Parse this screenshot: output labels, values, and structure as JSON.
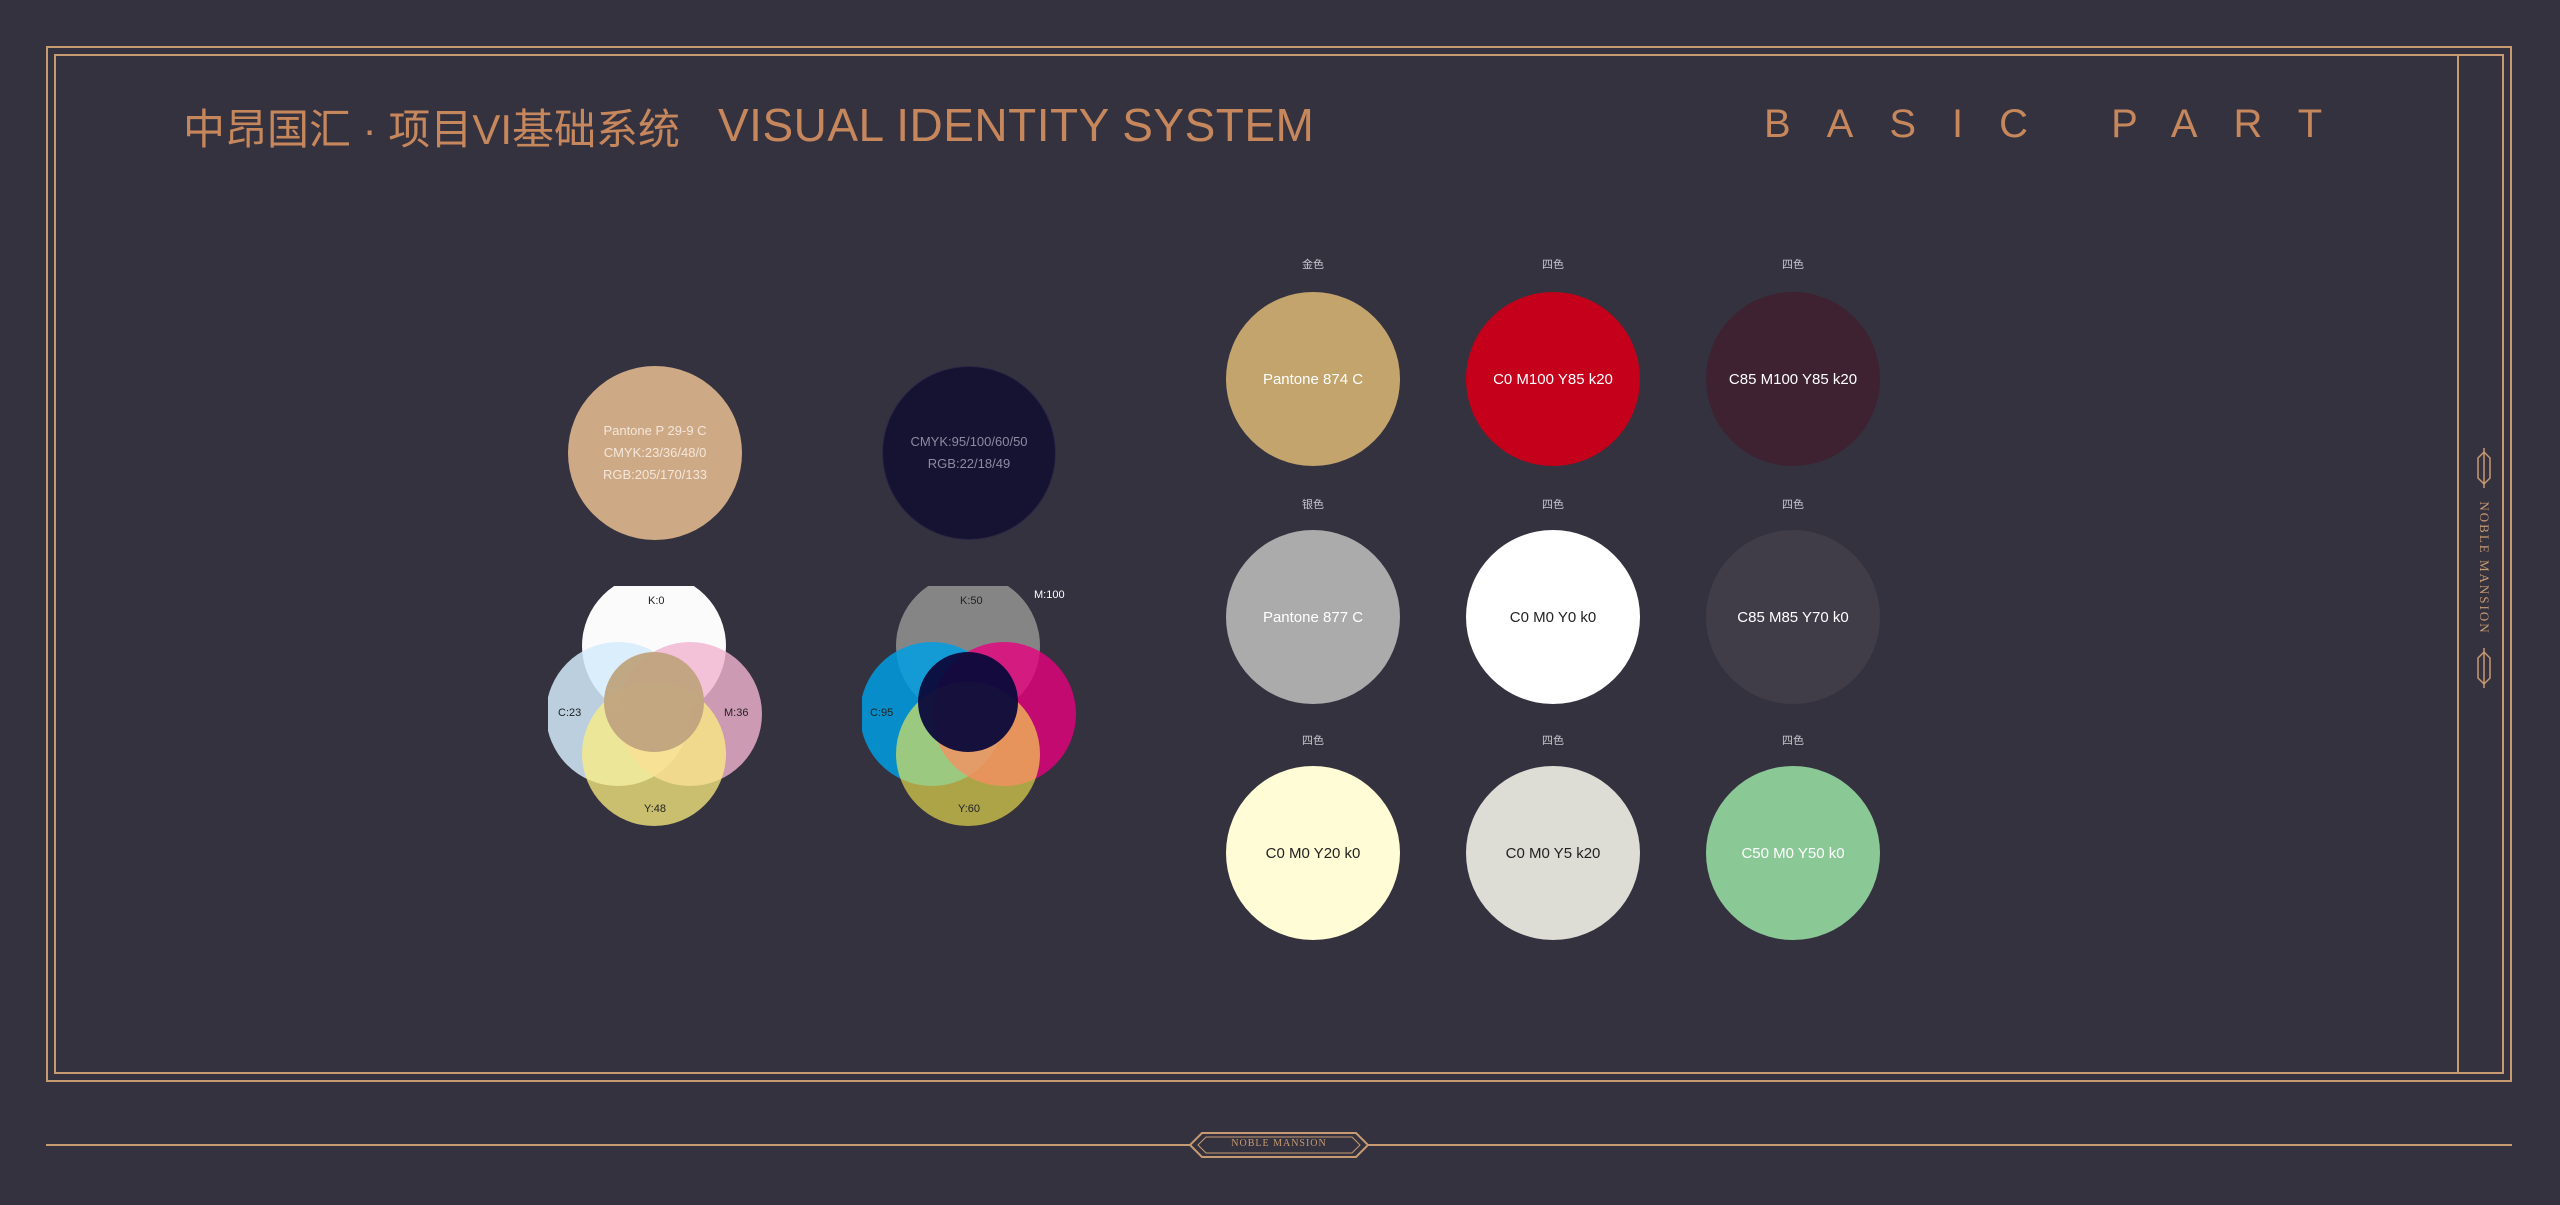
{
  "header": {
    "title_cn": "中昂国汇 · 项目VI基础系统",
    "title_en": "VISUAL IDENTITY SYSTEM",
    "section": "BASIC PART"
  },
  "brand": {
    "side_text": "NOBLE MANSION",
    "bottom_text": "NOBLE MANSION"
  },
  "colors": {
    "background": "#34323f",
    "gold_line": "#c89a72",
    "title_text": "#c7875c"
  },
  "standard_colors": [
    {
      "id": "gold",
      "hex": "#cdaa85",
      "lines": [
        "Pantone P 29-9 C",
        "CMYK:23/36/48/0",
        "RGB:205/170/133"
      ],
      "venn": {
        "k": "K:0",
        "c": "C:23",
        "m": "M:36",
        "y": "Y:48"
      }
    },
    {
      "id": "navy",
      "hex": "#161231",
      "lines": [
        "CMYK:95/100/60/50",
        "RGB:22/18/49"
      ],
      "venn": {
        "k": "K:50",
        "c": "C:95",
        "m": "M:100",
        "y": "Y:60"
      }
    }
  ],
  "swatches": [
    {
      "category": "金色",
      "label": "Pantone 874 C",
      "hex": "#c3a46c",
      "text_color": "#ffffff"
    },
    {
      "category": "四色",
      "label": "C0 M100 Y85 k20",
      "hex": "#c4001a",
      "text_color": "#ffffff"
    },
    {
      "category": "四色",
      "label": "C85 M100 Y85 k20",
      "hex": "#3e2232",
      "text_color": "#ffffff"
    },
    {
      "category": "银色",
      "label": "Pantone 877 C",
      "hex": "#ababab",
      "text_color": "#ffffff"
    },
    {
      "category": "四色",
      "label": "C0 M0 Y0 k0",
      "hex": "#ffffff",
      "text_color": "#222222"
    },
    {
      "category": "四色",
      "label": "C85 M85 Y70 k0",
      "hex": "#403d48",
      "text_color": "#ffffff"
    },
    {
      "category": "四色",
      "label": "C0 M0 Y20 k0",
      "hex": "#fffcd6",
      "text_color": "#222222"
    },
    {
      "category": "四色",
      "label": "C0 M0 Y5 k20",
      "hex": "#dddcd5",
      "text_color": "#222222"
    },
    {
      "category": "四色",
      "label": "C50 M0 Y50 k0",
      "hex": "#8ac896",
      "text_color": "#ffffff"
    }
  ]
}
